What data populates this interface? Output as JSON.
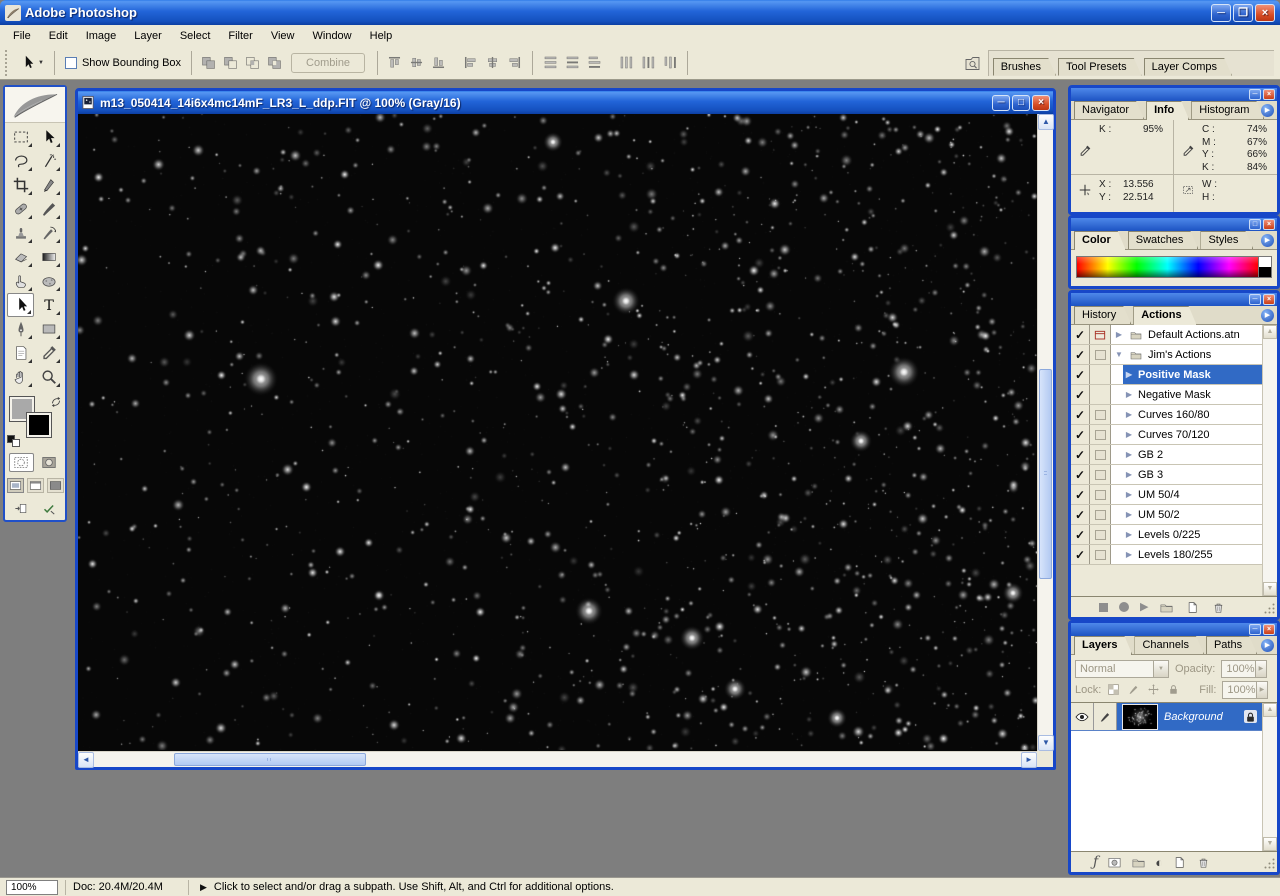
{
  "app": {
    "title": "Adobe Photoshop"
  },
  "menu": {
    "items": [
      "File",
      "Edit",
      "Image",
      "Layer",
      "Select",
      "Filter",
      "View",
      "Window",
      "Help"
    ]
  },
  "options": {
    "current_tool": "path-selection",
    "show_bounding_box_label": "Show Bounding Box",
    "combine_label": "Combine",
    "shape_buttons": [
      "add-to-shape-area",
      "subtract-from-shape-area",
      "intersect-shape-areas",
      "exclude-overlapping-shape-areas"
    ],
    "align_buttons": [
      "align-top-edges",
      "align-vertical-centers",
      "align-bottom-edges",
      "align-left-edges",
      "align-horizontal-centers",
      "align-right-edges",
      "distribute-top-edges",
      "distribute-vertical-centers",
      "distribute-bottom-edges",
      "distribute-left-edges",
      "distribute-horizontal-centers",
      "distribute-right-edges"
    ],
    "palette_well_tabs": [
      "Brushes",
      "Tool Presets",
      "Layer Comps"
    ]
  },
  "toolbox": {
    "tools": [
      {
        "name": "rectangular-marquee-tool",
        "icon": "marquee"
      },
      {
        "name": "move-tool",
        "icon": "move"
      },
      {
        "name": "lasso-tool",
        "icon": "lasso"
      },
      {
        "name": "magic-wand-tool",
        "icon": "wand"
      },
      {
        "name": "crop-tool",
        "icon": "crop"
      },
      {
        "name": "slice-tool",
        "icon": "slice"
      },
      {
        "name": "healing-brush-tool",
        "icon": "healing"
      },
      {
        "name": "brush-tool",
        "icon": "brush"
      },
      {
        "name": "clone-stamp-tool",
        "icon": "stamp"
      },
      {
        "name": "history-brush-tool",
        "icon": "history"
      },
      {
        "name": "eraser-tool",
        "icon": "eraser"
      },
      {
        "name": "gradient-tool",
        "icon": "gradient"
      },
      {
        "name": "smudge-tool",
        "icon": "smudge"
      },
      {
        "name": "sponge-tool",
        "icon": "sponge"
      },
      {
        "name": "path-selection-tool",
        "icon": "patharrow",
        "selected": true
      },
      {
        "name": "type-tool",
        "icon": "type"
      },
      {
        "name": "pen-tool",
        "icon": "pen"
      },
      {
        "name": "shape-tool",
        "icon": "shape"
      },
      {
        "name": "notes-tool",
        "icon": "notes"
      },
      {
        "name": "eyedropper-tool",
        "icon": "eyedropper"
      },
      {
        "name": "hand-tool",
        "icon": "hand"
      },
      {
        "name": "zoom-tool",
        "icon": "zoomglass"
      }
    ],
    "foreground_color": "#A9A9A9",
    "background_color": "#000000"
  },
  "document": {
    "title": "m13_050414_14i6x4mc14mF_LR3_L_ddp.FIT @ 100% (Gray/16)"
  },
  "panels": {
    "info": {
      "tabs": [
        "Navigator",
        "Info",
        "Histogram"
      ],
      "active_tab": "Info",
      "k": {
        "label": "K :",
        "value": "95%"
      },
      "c": {
        "label": "C :",
        "value": "74%"
      },
      "m": {
        "label": "M :",
        "value": "67%"
      },
      "yy": {
        "label": "Y :",
        "value": "66%"
      },
      "kk": {
        "label": "K :",
        "value": "84%"
      },
      "x": {
        "label": "X :",
        "value": "13.556"
      },
      "y": {
        "label": "Y :",
        "value": "22.514"
      },
      "w": {
        "label": "W :",
        "value": ""
      },
      "h": {
        "label": "H :",
        "value": ""
      }
    },
    "color": {
      "tabs": [
        "Color",
        "Swatches",
        "Styles"
      ],
      "active_tab": "Color"
    },
    "actions": {
      "tabs": [
        "History",
        "Actions"
      ],
      "active_tab": "Actions",
      "items": [
        {
          "label": "Default Actions.atn",
          "kind": "set",
          "arrow": "right",
          "check": true,
          "dialog": "red",
          "indent": 0,
          "selected": false
        },
        {
          "label": "Jim's Actions",
          "kind": "set",
          "arrow": "down",
          "check": true,
          "dialog": "box",
          "indent": 0,
          "selected": false
        },
        {
          "label": "Positive Mask",
          "kind": "action",
          "arrow": "right",
          "check": true,
          "dialog": "none",
          "indent": 1,
          "selected": true
        },
        {
          "label": "Negative Mask",
          "kind": "action",
          "arrow": "right",
          "check": true,
          "dialog": "none",
          "indent": 1,
          "selected": false
        },
        {
          "label": "Curves 160/80",
          "kind": "action",
          "arrow": "right",
          "check": true,
          "dialog": "box",
          "indent": 1,
          "selected": false
        },
        {
          "label": "Curves 70/120",
          "kind": "action",
          "arrow": "right",
          "check": true,
          "dialog": "box",
          "indent": 1,
          "selected": false
        },
        {
          "label": "GB 2",
          "kind": "action",
          "arrow": "right",
          "check": true,
          "dialog": "box",
          "indent": 1,
          "selected": false
        },
        {
          "label": "GB 3",
          "kind": "action",
          "arrow": "right",
          "check": true,
          "dialog": "box",
          "indent": 1,
          "selected": false
        },
        {
          "label": "UM 50/4",
          "kind": "action",
          "arrow": "right",
          "check": true,
          "dialog": "box",
          "indent": 1,
          "selected": false
        },
        {
          "label": "UM 50/2",
          "kind": "action",
          "arrow": "right",
          "check": true,
          "dialog": "box",
          "indent": 1,
          "selected": false
        },
        {
          "label": "Levels 0/225",
          "kind": "action",
          "arrow": "right",
          "check": true,
          "dialog": "box",
          "indent": 1,
          "selected": false
        },
        {
          "label": "Levels 180/255",
          "kind": "action",
          "arrow": "right",
          "check": true,
          "dialog": "box",
          "indent": 1,
          "selected": false
        }
      ]
    },
    "layers": {
      "tabs": [
        "Layers",
        "Channels",
        "Paths"
      ],
      "active_tab": "Layers",
      "blend_mode": "Normal",
      "opacity_label": "Opacity:",
      "opacity_value": "100%",
      "lock_label": "Lock:",
      "fill_label": "Fill:",
      "fill_value": "100%",
      "rows": [
        {
          "name": "Background",
          "selected": true,
          "locked": true,
          "visible": true
        }
      ]
    }
  },
  "status": {
    "zoom": "100%",
    "doc": "Doc: 20.4M/20.4M",
    "hint": "Click to select and/or drag a subpath. Use Shift, Alt, and Ctrl for additional options."
  },
  "colors": {
    "selection_blue": "#316AC5",
    "titlebar_blue": "#2264D8",
    "workspace_gray": "#7E7E7E",
    "chrome_beige": "#ECE9D8",
    "canvas_black": "#070707"
  }
}
